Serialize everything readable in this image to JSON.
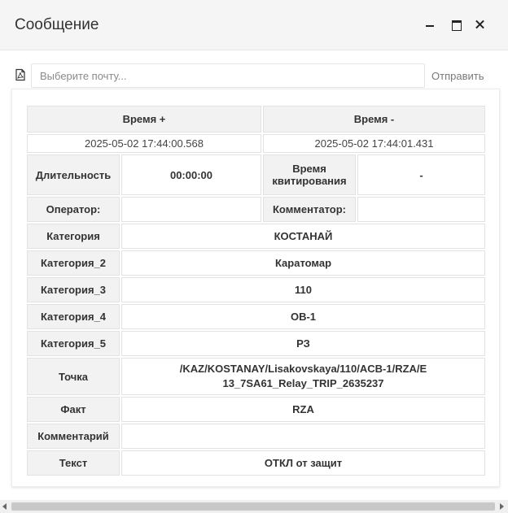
{
  "window": {
    "title": "Сообщение",
    "controls": [
      "minimize-icon",
      "maximize-icon",
      "close-icon"
    ]
  },
  "mail_bar": {
    "icon": "pdf-icon",
    "placeholder": "Выберите почту...",
    "value": "",
    "send_label": "Отправить"
  },
  "table": {
    "time_plus_label": "Время +",
    "time_minus_label": "Время -",
    "time_plus_value": "2025-05-02 17:44:00.568",
    "time_minus_value": "2025-05-02 17:44:01.431",
    "duration_label": "Длительность",
    "duration_value": "00:00:00",
    "ack_time_label": "Время квитирования",
    "ack_time_value": "-",
    "operator_label": "Оператор:",
    "operator_value": "",
    "commentator_label": "Комментатор:",
    "commentator_value": "",
    "rows": [
      {
        "label": "Категория",
        "value": "КОСТАНАЙ"
      },
      {
        "label": "Категория_2",
        "value": "Каратомар"
      },
      {
        "label": "Категория_3",
        "value": "110"
      },
      {
        "label": "Категория_4",
        "value": "ОВ-1"
      },
      {
        "label": "Категория_5",
        "value": "РЗ"
      },
      {
        "label": "Точка",
        "value": "/KAZ/KOSTANAY/Lisakovskaya/110/ACB-1/RZA/E13_7SA61_Relay_TRIP_2635237"
      },
      {
        "label": "Факт",
        "value": "RZA"
      },
      {
        "label": "Комментарий",
        "value": ""
      },
      {
        "label": "Текст",
        "value": "ОТКЛ от защит"
      }
    ]
  }
}
